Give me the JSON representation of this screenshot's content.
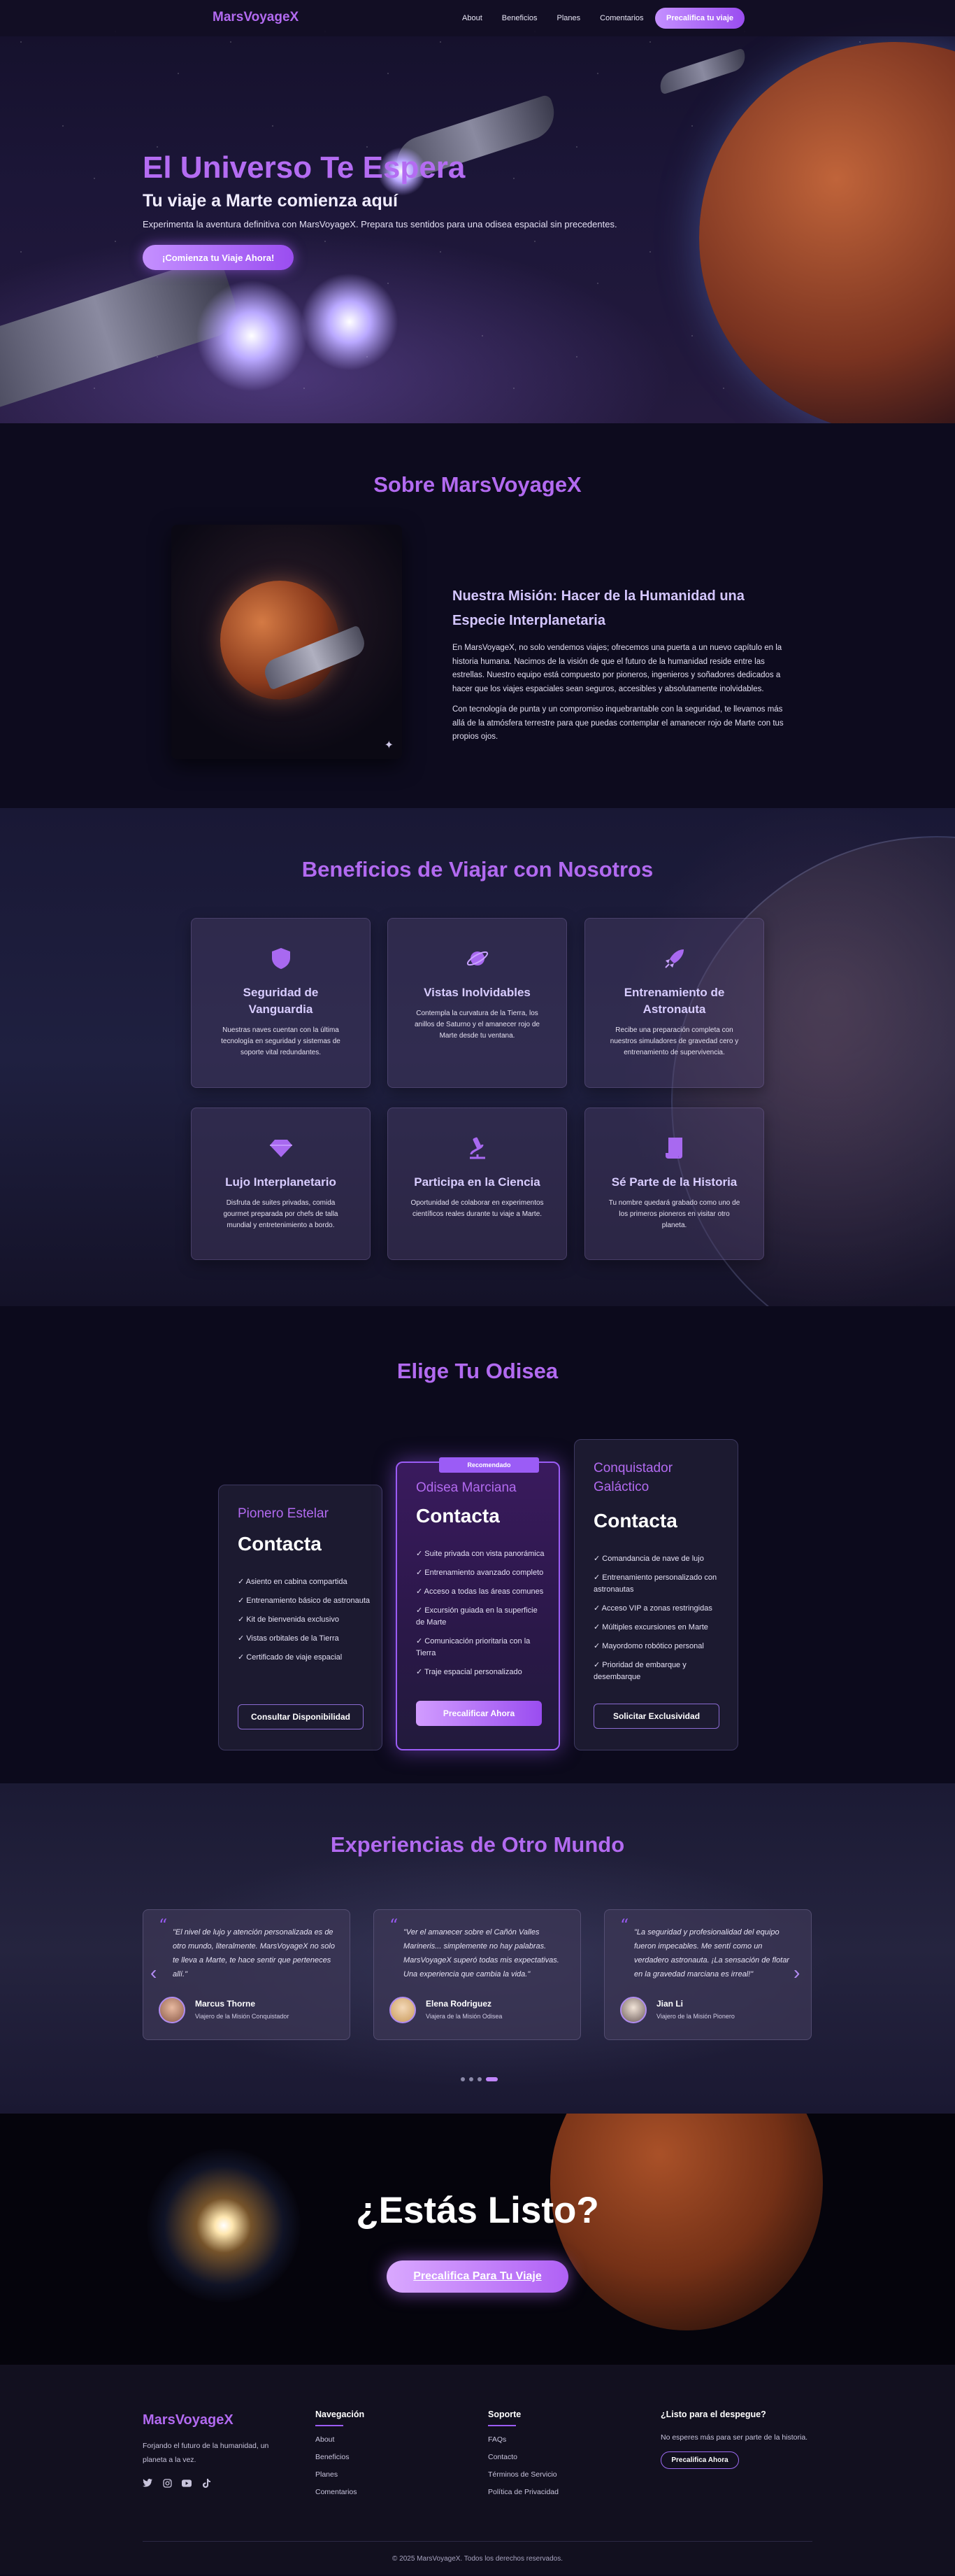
{
  "nav": {
    "logo": "MarsVoyageX",
    "links": [
      "About",
      "Beneficios",
      "Planes",
      "Comentarios"
    ],
    "cta": "Precalifica tu viaje"
  },
  "hero": {
    "title": "El Universo Te Espera",
    "subtitle": "Tu viaje a Marte comienza aquí",
    "text": "Experimenta la aventura definitiva con MarsVoyageX. Prepara tus sentidos para una odisea espacial sin precedentes.",
    "button": "¡Comienza tu Viaje Ahora!"
  },
  "about": {
    "title": "Sobre MarsVoyageX",
    "heading": "Nuestra Misión: Hacer de la Humanidad una Especie Interplanetaria",
    "p1": "En MarsVoyageX, no solo vendemos viajes; ofrecemos una puerta a un nuevo capítulo en la historia humana. Nacimos de la visión de que el futuro de la humanidad reside entre las estrellas. Nuestro equipo está compuesto por pioneros, ingenieros y soñadores dedicados a hacer que los viajes espaciales sean seguros, accesibles y absolutamente inolvidables.",
    "p2": "Con tecnología de punta y un compromiso inquebrantable con la seguridad, te llevamos más allá de la atmósfera terrestre para que puedas contemplar el amanecer rojo de Marte con tus propios ojos."
  },
  "benefits": {
    "title": "Beneficios de Viajar con Nosotros",
    "items": [
      {
        "icon": "shield-icon",
        "title": "Seguridad de Vanguardia",
        "text": "Nuestras naves cuentan con la última tecnología en seguridad y sistemas de soporte vital redundantes."
      },
      {
        "icon": "planet-icon",
        "title": "Vistas Inolvidables",
        "text": "Contempla la curvatura de la Tierra, los anillos de Saturno y el amanecer rojo de Marte desde tu ventana."
      },
      {
        "icon": "rocket-icon",
        "title": "Entrenamiento de Astronauta",
        "text": "Recibe una preparación completa con nuestros simuladores de gravedad cero y entrenamiento de supervivencia."
      },
      {
        "icon": "diamond-icon",
        "title": "Lujo Interplanetario",
        "text": "Disfruta de suites privadas, comida gourmet preparada por chefs de talla mundial y entretenimiento a bordo."
      },
      {
        "icon": "microscope-icon",
        "title": "Participa en la Ciencia",
        "text": "Oportunidad de colaborar en experimentos científicos reales durante tu viaje a Marte."
      },
      {
        "icon": "scroll-icon",
        "title": "Sé Parte de la Historia",
        "text": "Tu nombre quedará grabado como uno de los primeros pioneros en visitar otro planeta."
      }
    ]
  },
  "plans": {
    "title": "Elige Tu Odisea",
    "badge": "Recomendado",
    "items": [
      {
        "name": "Pionero Estelar",
        "price": "Contacta",
        "features": [
          "✓ Asiento en cabina compartida",
          "✓ Entrenamiento básico de astronauta",
          "✓ Kit de bienvenida exclusivo",
          "✓ Vistas orbitales de la Tierra",
          "✓ Certificado de viaje espacial"
        ],
        "button": "Consultar Disponibilidad"
      },
      {
        "name": "Odisea Marciana",
        "price": "Contacta",
        "features": [
          "✓ Suite privada con vista panorámica",
          "✓ Entrenamiento avanzado completo",
          "✓ Acceso a todas las áreas comunes",
          "✓ Excursión guiada en la superficie de Marte",
          "✓ Comunicación prioritaria con la Tierra",
          "✓ Traje espacial personalizado"
        ],
        "button": "Precalificar Ahora"
      },
      {
        "name": "Conquistador Galáctico",
        "price": "Contacta",
        "features": [
          "✓ Comandancia de nave de lujo",
          "✓ Entrenamiento personalizado con astronautas",
          "✓ Acceso VIP a zonas restringidas",
          "✓ Múltiples excursiones en Marte",
          "✓ Mayordomo robótico personal",
          "✓ Prioridad de embarque y desembarque"
        ],
        "button": "Solicitar Exclusividad"
      }
    ]
  },
  "testimonials": {
    "title": "Experiencias de Otro Mundo",
    "items": [
      {
        "quote": "\"El nivel de lujo y atención personalizada es de otro mundo, literalmente. MarsVoyageX no solo te lleva a Marte, te hace sentir que perteneces allí.\"",
        "name": "Marcus Thorne",
        "role": "Viajero de la Misión Conquistador"
      },
      {
        "quote": "\"Ver el amanecer sobre el Cañón Valles Marineris... simplemente no hay palabras. MarsVoyageX superó todas mis expectativas. Una experiencia que cambia la vida.\"",
        "name": "Elena Rodriguez",
        "role": "Viajera de la Misión Odisea"
      },
      {
        "quote": "\"La seguridad y profesionalidad del equipo fueron impecables. Me sentí como un verdadero astronauta. ¡La sensación de flotar en la gravedad marciana es irreal!\"",
        "name": "Jian Li",
        "role": "Viajero de la Misión Pionero"
      }
    ],
    "active_dot": 4
  },
  "cta": {
    "title": "¿Estás Listo?",
    "button": "Precalifica Para Tu Viaje"
  },
  "footer": {
    "logo": "MarsVoyageX",
    "tagline": "Forjando el futuro de la humanidad, un planeta a la vez.",
    "social": [
      "twitter-icon",
      "instagram-icon",
      "youtube-icon",
      "tiktok-icon"
    ],
    "nav_title": "Navegación",
    "nav_links": [
      "About",
      "Beneficios",
      "Planes",
      "Comentarios"
    ],
    "support_title": "Soporte",
    "support_links": [
      "FAQs",
      "Contacto",
      "Términos de Servicio",
      "Política de Privacidad"
    ],
    "ready_title": "¿Listo para el despegue?",
    "ready_text": "No esperes más para ser parte de la historia.",
    "ready_button": "Precalifica Ahora",
    "copyright": "© 2025 MarsVoyageX. Todos los derechos reservados."
  },
  "colors": {
    "accent": "#b26af0",
    "button": "#9a4df0",
    "background": "#0c0a1c"
  }
}
